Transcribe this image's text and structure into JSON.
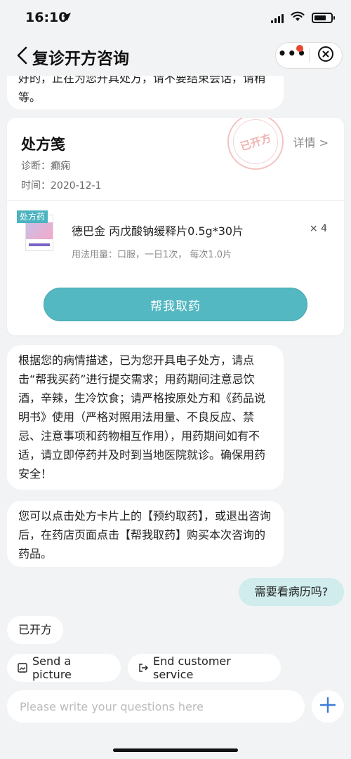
{
  "status_bar": {
    "time": "16:10"
  },
  "nav": {
    "title": "复诊开方咨询"
  },
  "messages": {
    "first_partial": "好的，正在为您开具处方，请不要结束会话，请稍等。",
    "msg2": "根据您的病情描述，已为您开具电子处方，请点击“帮我买药”进行提交需求；用药期间注意忌饮酒，辛辣，生冷饮食；请严格按原处方和《药品说明书》使用（严格对照用法用量、不良反应、禁忌、注意事项和药物相互作用），用药期间如有不适，请立即停药并及时到当地医院就诊。确保用药安全！",
    "msg3": "您可以点击处方卡片上的【预约取药】，或退出咨询后，在药店页面点击【帮我取药】购买本次咨询的药品。",
    "user_msg": "需要看病历吗?",
    "short_msg": "已开方"
  },
  "prescription": {
    "title": "处方笺",
    "detail_link": "详情 >",
    "diagnosis_label": "诊断：",
    "diagnosis": "癫痫",
    "time_label": "时间：",
    "time": "2020-12-1",
    "stamp_text": "已开方",
    "tag": "处方药",
    "drug_name": "德巴金 丙戊酸钠缓释片0.5g*30片",
    "quantity": "× 4",
    "usage": "用法用量：口服，一日1次， 每次1.0片",
    "button_label": "帮我取药"
  },
  "quick_replies": {
    "send_picture": "Send a picture",
    "end_service": "End customer service"
  },
  "input": {
    "placeholder": "Please write your questions here"
  },
  "colors": {
    "accent": "#53b8c2",
    "user_bubble": "#d0ecec",
    "badge": "#e8472f"
  }
}
